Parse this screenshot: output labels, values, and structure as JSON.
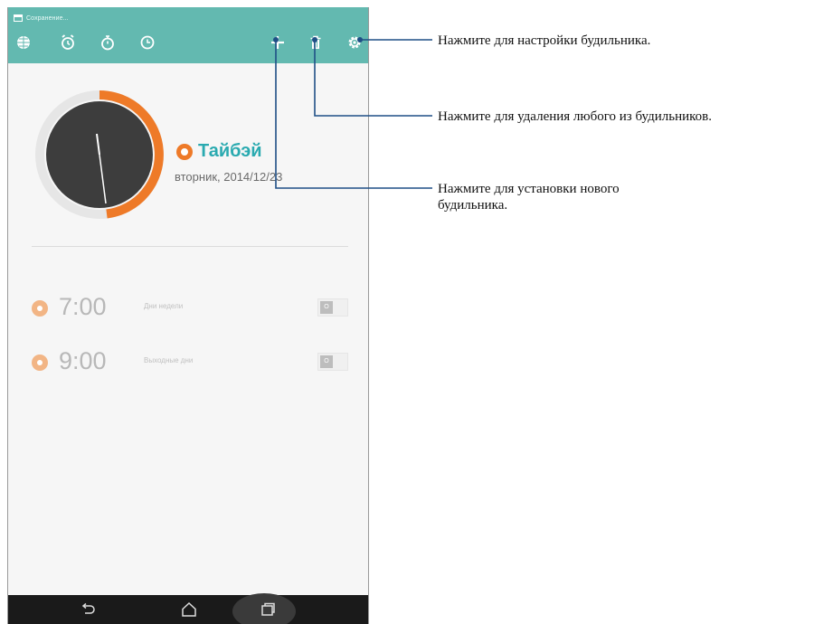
{
  "status_bar": {
    "text": "Сохранение..."
  },
  "toolbar": {
    "icons": [
      "globe-icon",
      "alarm-clock-icon",
      "stopwatch-icon",
      "timer-icon",
      "plus-icon",
      "trash-icon",
      "gear-icon"
    ]
  },
  "world_clock": {
    "city": "Тайбэй",
    "date": "вторник, 2014/12/23",
    "accent_color": "#ee7a28",
    "city_color": "#2aaab0"
  },
  "alarms": [
    {
      "time": "7:00",
      "repeat": "Дни недели",
      "toggle": "О"
    },
    {
      "time": "9:00",
      "repeat": "Выходные дни",
      "toggle": "О"
    }
  ],
  "nav_bar": {
    "icons": [
      "back-icon",
      "home-icon",
      "recent-apps-icon"
    ]
  },
  "callouts": {
    "settings": "Нажмите для настройки будильника.",
    "delete": "Нажмите для удаления любого из будильников.",
    "add_line1": "Нажмите для установки нового",
    "add_line2": "будильника."
  },
  "colors": {
    "toolbar": "#63b9b0",
    "leader_line": "#1f4f86"
  }
}
